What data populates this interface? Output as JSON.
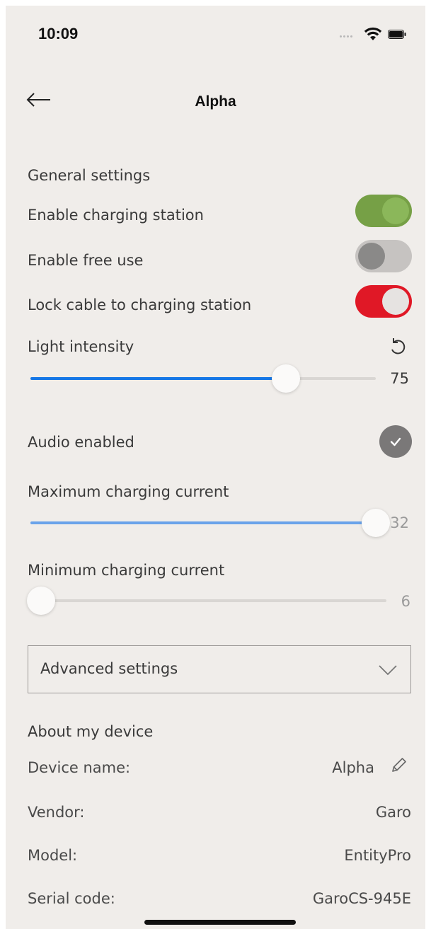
{
  "status_bar": {
    "time": "10:09",
    "icons": [
      "signal-dots-icon",
      "wifi-icon",
      "battery-icon"
    ]
  },
  "header": {
    "back_icon": "arrow-left-icon",
    "title": "Alpha"
  },
  "general": {
    "section_title": "General settings",
    "enable_charging": {
      "label": "Enable charging station",
      "on": true,
      "color": "#76a046"
    },
    "enable_free_use": {
      "label": "Enable free use",
      "on": false,
      "color": "#c6c3c1"
    },
    "lock_cable": {
      "label": "Lock cable to charging station",
      "on": true,
      "color": "#e01826"
    }
  },
  "light_intensity": {
    "label": "Light intensity",
    "reset_icon": "reset-icon",
    "value": "75",
    "fraction": 0.74,
    "color": "#1677e6"
  },
  "audio": {
    "label": "Audio enabled",
    "checked": true,
    "check_icon": "check-icon"
  },
  "max_current": {
    "label": "Maximum charging current",
    "value": "32",
    "fraction": 1.0,
    "color": "#6aa3ea"
  },
  "min_current": {
    "label": "Minimum charging current",
    "value": "6",
    "fraction": 0.0,
    "color": "#d9d6d3"
  },
  "advanced": {
    "label": "Advanced settings",
    "chevron_icon": "chevron-down-icon"
  },
  "about": {
    "section_title": "About my device",
    "device_name_label": "Device name:",
    "device_name_value": "Alpha",
    "edit_icon": "pencil-icon",
    "vendor_label": "Vendor:",
    "vendor_value": "Garo",
    "model_label": "Model:",
    "model_value": "EntityPro",
    "serial_label": "Serial code:",
    "serial_value": "GaroCS-945E"
  }
}
